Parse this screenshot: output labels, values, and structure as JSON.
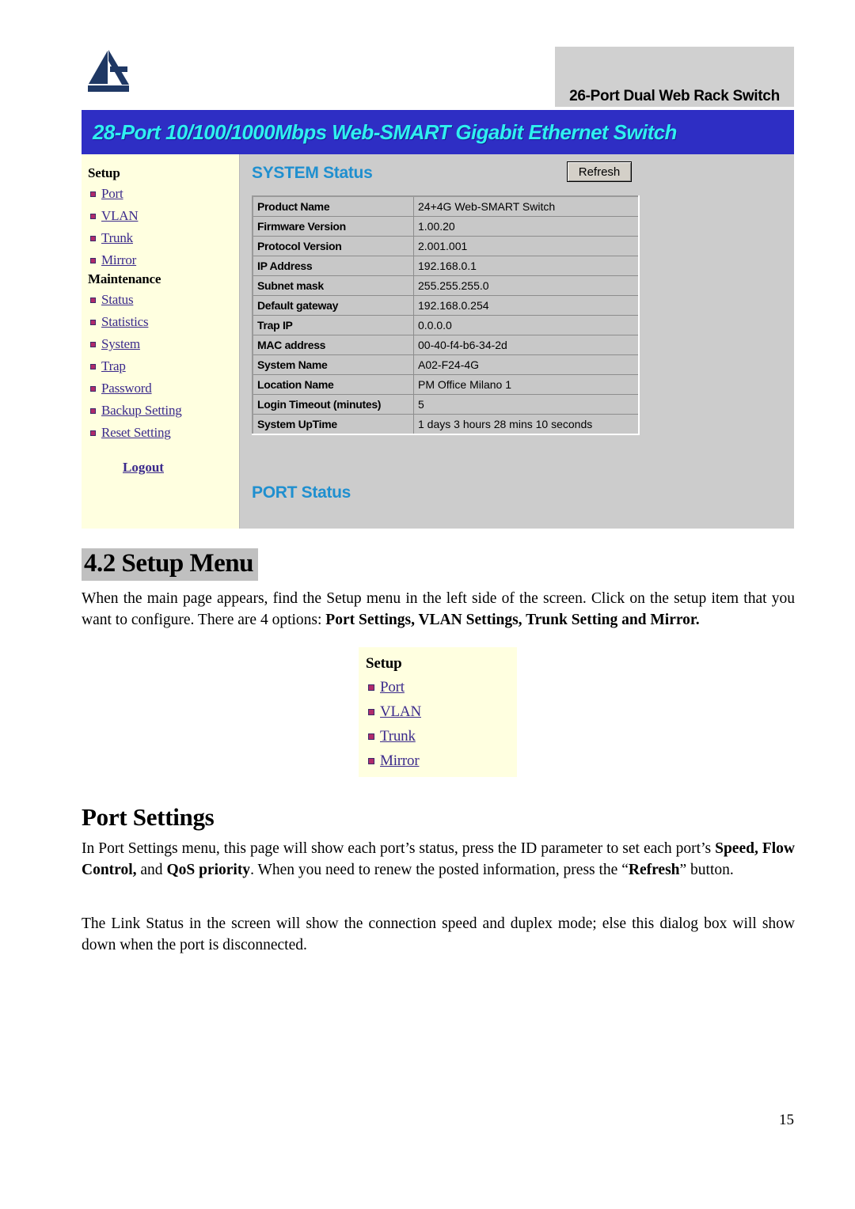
{
  "screenshot": {
    "model_banner": "26-Port Dual Web Rack Switch",
    "product_banner": "28-Port 10/100/1000Mbps Web-SMART Gigabit Ethernet Switch",
    "logo_name": "atlantis-land-logo",
    "sidebar": {
      "groups": [
        {
          "title": "Setup",
          "items": [
            {
              "label": "Port"
            },
            {
              "label": "VLAN"
            },
            {
              "label": "Trunk"
            },
            {
              "label": "Mirror"
            }
          ]
        },
        {
          "title": "Maintenance",
          "items": [
            {
              "label": "Status"
            },
            {
              "label": "Statistics"
            },
            {
              "label": "System"
            },
            {
              "label": "Trap"
            },
            {
              "label": "Password"
            },
            {
              "label": "Backup Setting"
            },
            {
              "label": "Reset Setting"
            }
          ]
        }
      ],
      "logout_label": "Logout"
    },
    "system_status": {
      "title": "SYSTEM Status",
      "refresh_label": "Refresh",
      "rows": [
        {
          "key": "Product Name",
          "value": "24+4G Web-SMART Switch"
        },
        {
          "key": "Firmware Version",
          "value": "1.00.20"
        },
        {
          "key": "Protocol Version",
          "value": "2.001.001"
        },
        {
          "key": "IP Address",
          "value": "192.168.0.1"
        },
        {
          "key": "Subnet mask",
          "value": "255.255.255.0"
        },
        {
          "key": "Default gateway",
          "value": "192.168.0.254"
        },
        {
          "key": "Trap IP",
          "value": "0.0.0.0"
        },
        {
          "key": "MAC address",
          "value": "00-40-f4-b6-34-2d"
        },
        {
          "key": "System Name",
          "value": "A02-F24-4G"
        },
        {
          "key": "Location Name",
          "value": "PM Office Milano 1"
        },
        {
          "key": "Login Timeout (minutes)",
          "value": "5"
        },
        {
          "key": "System UpTime",
          "value": "1 days 3 hours 28 mins 10 seconds"
        }
      ]
    },
    "port_status_title": "PORT Status"
  },
  "document": {
    "heading_42": "4.2 Setup Menu",
    "para1_a": "When the main page appears, find the Setup menu in the left side of the screen. Click on the setup item that you want to configure. There are 4 options: ",
    "para1_b": "Port Settings, VLAN Settings, Trunk Setting and Mirror.",
    "heading_port_settings": "Port Settings",
    "para2_a": "In Port Settings menu, this page will show each port’s status, press the ID parameter to set each port’s ",
    "para2_b": "Speed, Flow Control,",
    "para2_c": " and ",
    "para2_d": "QoS priority",
    "para2_e": ". When you need to renew the posted information, press the “",
    "para2_f": "Refresh",
    "para2_g": "” button.",
    "para3": "The Link Status in the screen will show the connection speed and duplex mode; else this dialog box will show down when the port is disconnected.",
    "page_number": "15"
  },
  "setup_figure": {
    "title": "Setup",
    "items": [
      {
        "label": "Port"
      },
      {
        "label": "VLAN"
      },
      {
        "label": "Trunk"
      },
      {
        "label": "Mirror"
      }
    ]
  },
  "colors": {
    "banner_blue": "#2e2ec4",
    "banner_text_cyan": "#2ff0f0",
    "sidebar_cream": "#ffffe0",
    "link_purple": "#3b2a8c",
    "bullet_magenta": "#b02a6b",
    "section_title_blue": "#1f8fcf",
    "panel_gray": "#cccccc",
    "highlight_gray": "#c0c0c0"
  }
}
